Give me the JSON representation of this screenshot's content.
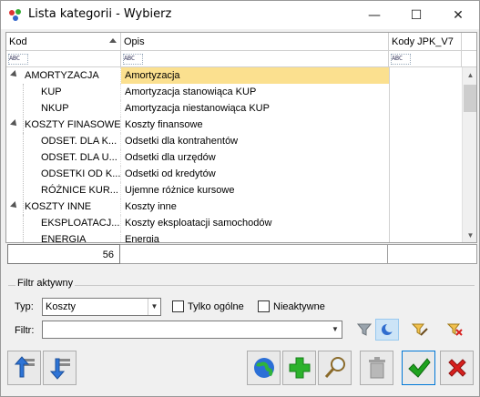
{
  "window": {
    "title": "Lista kategorii - Wybierz",
    "minimize": "—",
    "maximize": "☐",
    "close": "✕"
  },
  "grid": {
    "columns": [
      "Kod",
      "Opis",
      "Kody JPK_V7"
    ],
    "filter_placeholder": "ABC",
    "rows": [
      {
        "kod": "AMORTYZACJA",
        "opis": "Amortyzacja",
        "jpk": "",
        "level": 0,
        "expanded": true,
        "selected": true
      },
      {
        "kod": "KUP",
        "opis": "Amortyzacja stanowiąca KUP",
        "jpk": "",
        "level": 1
      },
      {
        "kod": "NKUP",
        "opis": "Amortyzacja niestanowiąca KUP",
        "jpk": "",
        "level": 1
      },
      {
        "kod": "KOSZTY FINASOWE",
        "opis": "Koszty finansowe",
        "jpk": "",
        "level": 0,
        "expanded": true
      },
      {
        "kod": "ODSET. DLA K...",
        "opis": "Odsetki dla kontrahentów",
        "jpk": "",
        "level": 1
      },
      {
        "kod": "ODSET. DLA U...",
        "opis": "Odsetki dla urzędów",
        "jpk": "",
        "level": 1
      },
      {
        "kod": "ODSETKI OD K...",
        "opis": "Odsetki od kredytów",
        "jpk": "",
        "level": 1
      },
      {
        "kod": "RÓŻNICE KUR...",
        "opis": "Ujemne różnice kursowe",
        "jpk": "",
        "level": 1
      },
      {
        "kod": "KOSZTY INNE",
        "opis": "Koszty inne",
        "jpk": "",
        "level": 0,
        "expanded": true
      },
      {
        "kod": "EKSPLOATACJ...",
        "opis": "Koszty eksploatacji samochodów",
        "jpk": "",
        "level": 1
      },
      {
        "kod": "ENERGIA",
        "opis": "Energia",
        "jpk": "",
        "level": 1
      }
    ],
    "count": "56"
  },
  "filter_group": {
    "title": "Filtr aktywny",
    "typ_label": "Typ:",
    "typ_value": "Koszty",
    "tylko_ogolne": "Tylko ogólne",
    "nieaktywne": "Nieaktywne",
    "filtr_label": "Filtr:",
    "filtr_value": ""
  },
  "icons": {
    "app": "categories-icon",
    "filter": "funnel-icon",
    "moon": "moon-toggle-icon",
    "build_filter": "filter-build-icon",
    "clear_filter": "filter-clear-icon",
    "move_up": "move-up-icon",
    "move_down": "move-down-icon",
    "web": "globe-icon",
    "add": "plus-icon",
    "edit": "magnifier-icon",
    "delete": "trash-icon",
    "ok": "checkmark-icon",
    "cancel": "cross-icon"
  },
  "colors": {
    "selected_row": "#fbe08f",
    "ok_green": "#1fa31f",
    "cancel_red": "#d7201e",
    "add_green": "#2cb22c"
  }
}
